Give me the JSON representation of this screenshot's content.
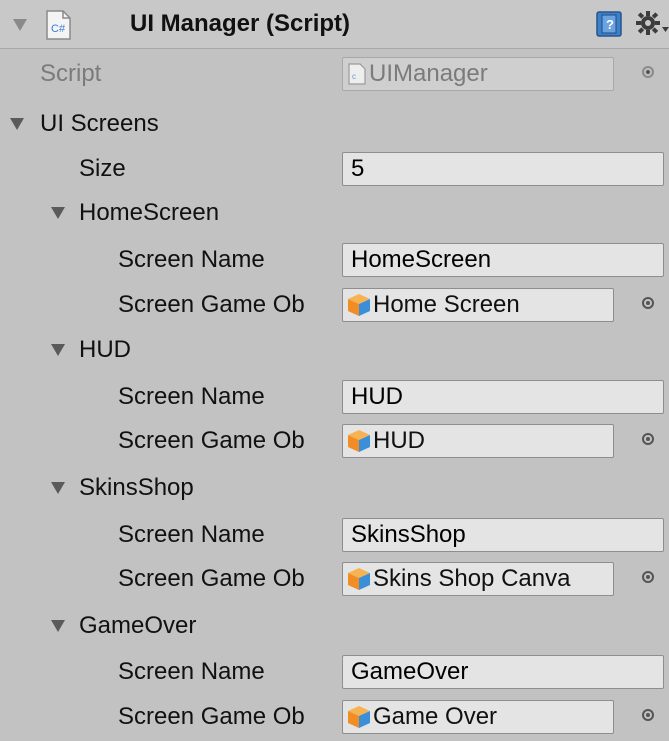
{
  "component": {
    "title": "UI Manager (Script)",
    "script_label": "Script",
    "script_value": "UIManager",
    "cs_icon_text": "C#"
  },
  "list": {
    "label": "UI Screens",
    "size_label": "Size",
    "size_value": "5",
    "screen_name_label": "Screen Name",
    "game_object_label": "Screen Game Ob",
    "elements": [
      {
        "header": "HomeScreen",
        "screen_name": "HomeScreen",
        "game_object": "Home Screen"
      },
      {
        "header": "HUD",
        "screen_name": "HUD",
        "game_object": "HUD"
      },
      {
        "header": "SkinsShop",
        "screen_name": "SkinsShop",
        "game_object": "Skins Shop Canva"
      },
      {
        "header": "GameOver",
        "screen_name": "GameOver",
        "game_object": "Game Over"
      }
    ]
  },
  "colors": {
    "panel_bg": "#c2c2c2",
    "field_bg": "#e4e4e4",
    "cube_orange": "#f39a2b",
    "cube_blue": "#3b8fd8"
  },
  "icons": [
    "foldout-triangle-icon",
    "csharp-script-icon",
    "help-book-icon",
    "gear-icon",
    "object-picker-icon",
    "gameobject-cube-icon"
  ]
}
